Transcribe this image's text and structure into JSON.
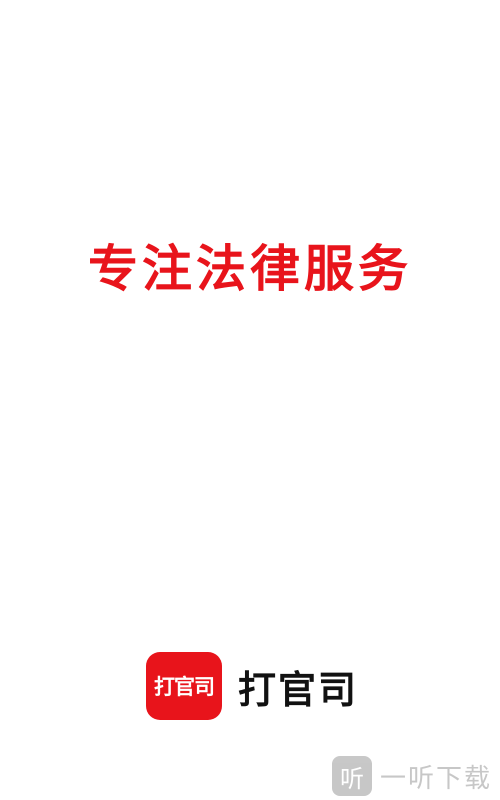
{
  "splash": {
    "slogan": "专注法律服务"
  },
  "brand": {
    "icon_text": "打官司",
    "app_name": "打官司",
    "accent_color": "#e8141b"
  },
  "watermark": {
    "badge_text": "听",
    "text": "一听下载"
  }
}
